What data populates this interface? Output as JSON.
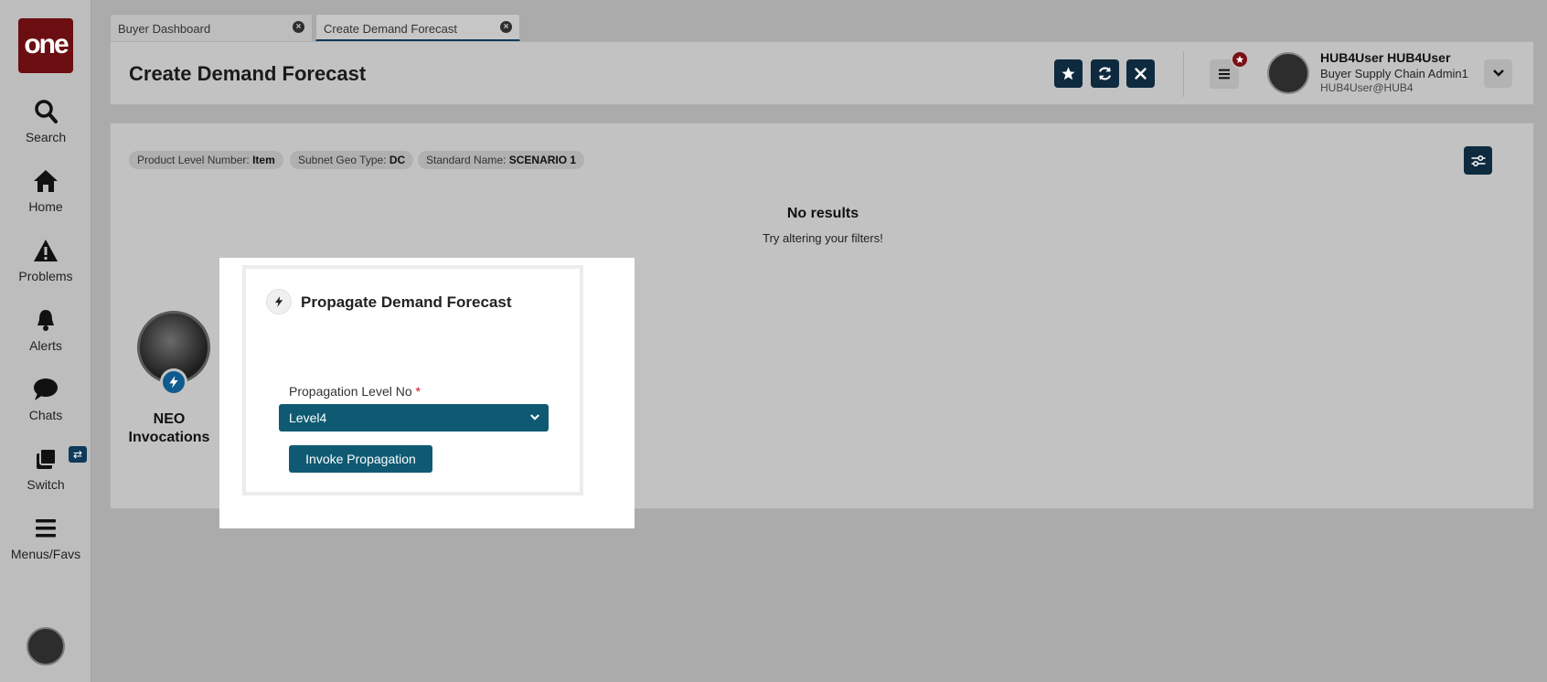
{
  "app": {
    "logo_text": "one"
  },
  "sidebar": {
    "items": [
      {
        "label": "Search",
        "icon": "search-icon"
      },
      {
        "label": "Home",
        "icon": "home-icon"
      },
      {
        "label": "Problems",
        "icon": "warning-icon"
      },
      {
        "label": "Alerts",
        "icon": "bell-icon"
      },
      {
        "label": "Chats",
        "icon": "chat-icon"
      },
      {
        "label": "Switch",
        "icon": "switch-icon"
      },
      {
        "label": "Menus/Favs",
        "icon": "hamburger-icon"
      }
    ],
    "switch_badge": "⇄"
  },
  "tabs": [
    {
      "label": "Buyer Dashboard"
    },
    {
      "label": "Create Demand Forecast",
      "active": true
    }
  ],
  "header": {
    "title": "Create Demand Forecast",
    "user": {
      "name": "HUB4User HUB4User",
      "role": "Buyer Supply Chain Admin1",
      "email": "HUB4User@HUB4"
    }
  },
  "filters": [
    {
      "key": "Product Level Number:",
      "value": "Item"
    },
    {
      "key": "Subnet Geo Type:",
      "value": "DC"
    },
    {
      "key": "Standard Name:",
      "value": "SCENARIO 1"
    }
  ],
  "results": {
    "empty_title": "No results",
    "empty_subtitle": "Try altering your filters!"
  },
  "neo": {
    "label_line1": "NEO",
    "label_line2": "Invocations"
  },
  "modal": {
    "title": "Propagate Demand Forecast",
    "field_label": "Propagation Level No",
    "required_mark": "*",
    "selected_value": "Level4",
    "button_label": "Invoke Propagation"
  },
  "colors": {
    "brand": "#6b0e12",
    "primary_dark": "#0e2a3f",
    "teal": "#0f5a72",
    "required": "#d0101c"
  }
}
